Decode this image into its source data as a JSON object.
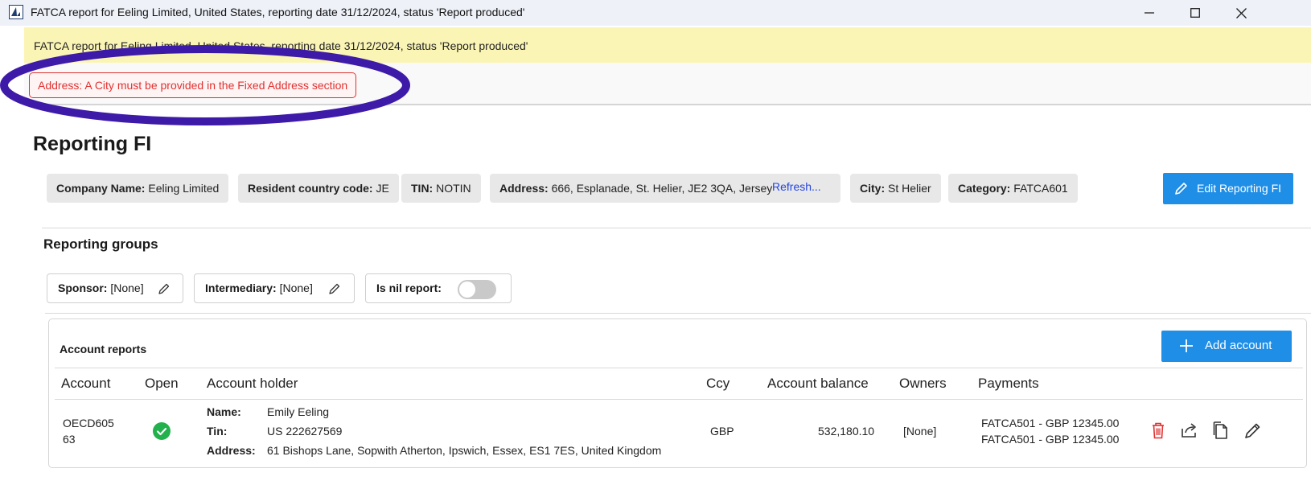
{
  "window": {
    "title": "FATCA report for Eeling Limited, United States, reporting date 31/12/2024, status 'Report produced'"
  },
  "status_bar": {
    "text": "FATCA report for Eeling Limited, United States, reporting date 31/12/2024, status 'Report produced'"
  },
  "validation": {
    "error": "Address: A City must be provided in the Fixed Address section"
  },
  "reporting_fi": {
    "heading": "Reporting FI",
    "fields": [
      {
        "label": "Company Name:",
        "value": "Eeling Limited"
      },
      {
        "label": "Resident country code:",
        "value": "JE"
      },
      {
        "label": "TIN:",
        "value": "NOTIN"
      },
      {
        "label": "Address:",
        "value": "666, Esplanade, St. Helier, JE2 3QA, Jersey"
      },
      {
        "label": "City:",
        "value": "St Helier"
      },
      {
        "label": "Category:",
        "value": "FATCA601"
      }
    ],
    "refresh_link": "Refresh...",
    "edit_button": "Edit Reporting FI"
  },
  "reporting_groups": {
    "heading": "Reporting groups",
    "sponsor": {
      "label": "Sponsor:",
      "value": "[None]"
    },
    "intermediary": {
      "label": "Intermediary:",
      "value": "[None]"
    },
    "nil_report": {
      "label": "Is nil report:",
      "checked": false
    }
  },
  "account_reports": {
    "title": "Account reports",
    "add_button": "Add account",
    "columns": [
      "Account",
      "Open",
      "Account holder",
      "Ccy",
      "Account balance",
      "Owners",
      "Payments"
    ],
    "rows": [
      {
        "account_line1": "OECD605",
        "account_line2": "63",
        "open": true,
        "holder": {
          "name_label": "Name:",
          "name": "Emily Eeling",
          "tin_label": "Tin:",
          "tin": "US 222627569",
          "address_label": "Address:",
          "address": "61 Bishops Lane, Sopwith Atherton, Ipswich, Essex, ES1 7ES, United Kingdom"
        },
        "ccy": "GBP",
        "balance": "532,180.10",
        "owners": "[None]",
        "payments": [
          "FATCA501 - GBP 12345.00",
          "FATCA501 - GBP 12345.00"
        ]
      }
    ]
  },
  "colors": {
    "accent": "#1e8ee6",
    "error": "#e03131",
    "status_bg": "#fbf5b5",
    "annotation": "#3d1aa8",
    "open_ok": "#22b14c",
    "delete": "#e03131"
  }
}
